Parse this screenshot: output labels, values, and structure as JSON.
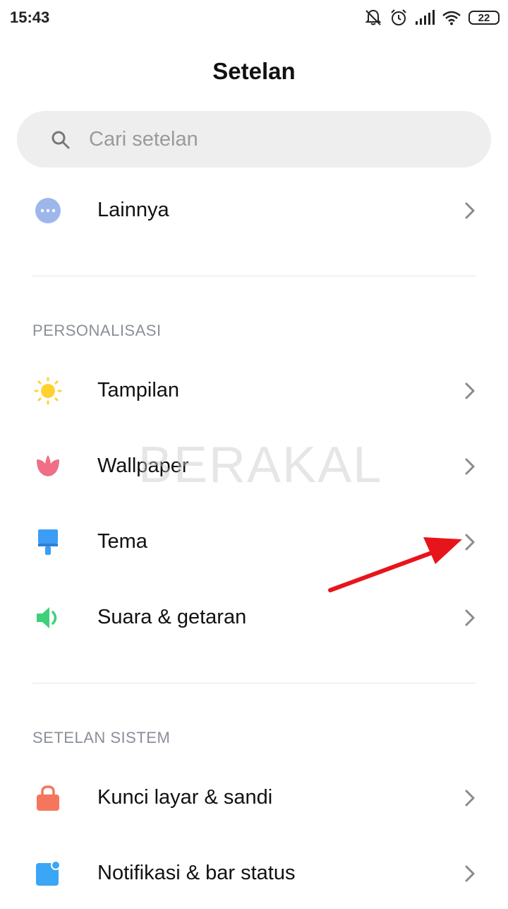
{
  "status": {
    "time": "15:43",
    "battery": "22"
  },
  "header": {
    "title": "Setelan"
  },
  "search": {
    "placeholder": "Cari setelan"
  },
  "rows": [
    {
      "label": "Lainnya"
    },
    {
      "label": "Tampilan"
    },
    {
      "label": "Wallpaper"
    },
    {
      "label": "Tema"
    },
    {
      "label": "Suara & getaran"
    },
    {
      "label": "Kunci layar & sandi"
    },
    {
      "label": "Notifikasi & bar status"
    }
  ],
  "sections": {
    "personalization": "PERSONALISASI",
    "system": "SETELAN SISTEM"
  },
  "watermark": "BERAKAL",
  "colors": {
    "more_icon": "#9db7ec",
    "display_icon": "#ffd230",
    "wallpaper_icon": "#f06e86",
    "theme_icon": "#3d9cf5",
    "sound_icon": "#3fd07a",
    "lock_icon": "#f4775d",
    "notif_icon": "#3aa6f5",
    "annotation_arrow": "#e8141c"
  }
}
